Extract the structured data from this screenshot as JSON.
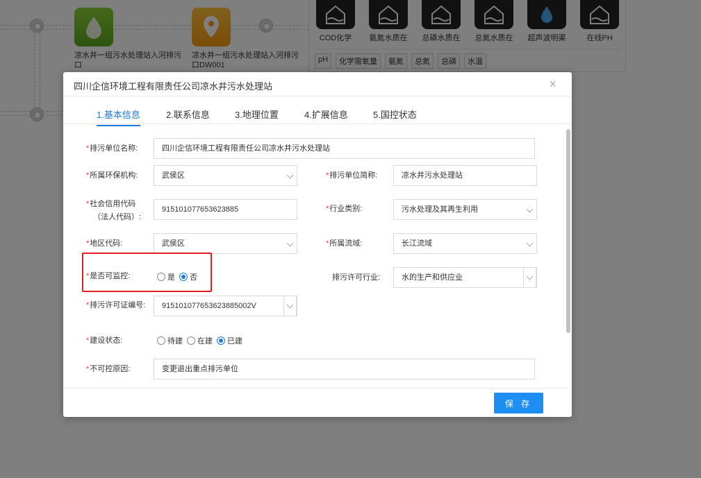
{
  "background": {
    "sites": [
      {
        "name": "凉水井一组污水处理站入河排污口"
      },
      {
        "name": "凉水井一组污水处理站入河排污口DW001"
      }
    ],
    "monitors": [
      {
        "label": "COD化学"
      },
      {
        "label": "氨氮水质在"
      },
      {
        "label": "总磷水质在"
      },
      {
        "label": "总氮水质在"
      },
      {
        "label": "超声波明渠"
      },
      {
        "label": "在线PH"
      }
    ],
    "chips": [
      "pH",
      "化学需氧量",
      "氨氮",
      "总氮",
      "总磷",
      "水温"
    ]
  },
  "dialog": {
    "title": "四川企信环境工程有限责任公司凉水井污水处理站",
    "close": "×",
    "tabs": [
      {
        "label": "1.基本信息",
        "active": true
      },
      {
        "label": "2.联系信息"
      },
      {
        "label": "3.地理位置"
      },
      {
        "label": "4.扩展信息"
      },
      {
        "label": "5.国控状态"
      }
    ],
    "form": {
      "unit_name_label": "排污单位名称:",
      "unit_name_value": "四川企信环境工程有限责任公司凉水井污水处理站",
      "agency_label": "所属环保机构:",
      "agency_value": "武侯区",
      "short_name_label": "排污单位简称:",
      "short_name_value": "凉水井污水处理站",
      "credit_code_label_1": "社会信用代码",
      "credit_code_label_2": "（法人代码）:",
      "credit_code_value": "915101077653623885",
      "industry_label": "行业类别:",
      "industry_value": "污水处理及其再生利用",
      "region_label": "地区代码:",
      "region_value": "武侯区",
      "basin_label": "所属流域:",
      "basin_value": "长江流域",
      "monitorable_label": "是否可监控:",
      "monitorable_yes": "是",
      "monitorable_no": "否",
      "permit_industry_label": "排污许可行业:",
      "permit_industry_value": "水的生产和供应业",
      "permit_no_label": "排污许可证编号:",
      "permit_no_value": "915101077653623885002V",
      "construction_label": "建设状态:",
      "construction_options": [
        "待建",
        "在建",
        "已建"
      ],
      "uncontrollable_label": "不可控原因:",
      "uncontrollable_value": "变更退出重点排污单位"
    },
    "save_label": "保 存"
  },
  "colors": {
    "accent": "#1e78d6",
    "button": "#1e8ef2",
    "required": "#e4393c",
    "highlight": "#e81c1c"
  }
}
